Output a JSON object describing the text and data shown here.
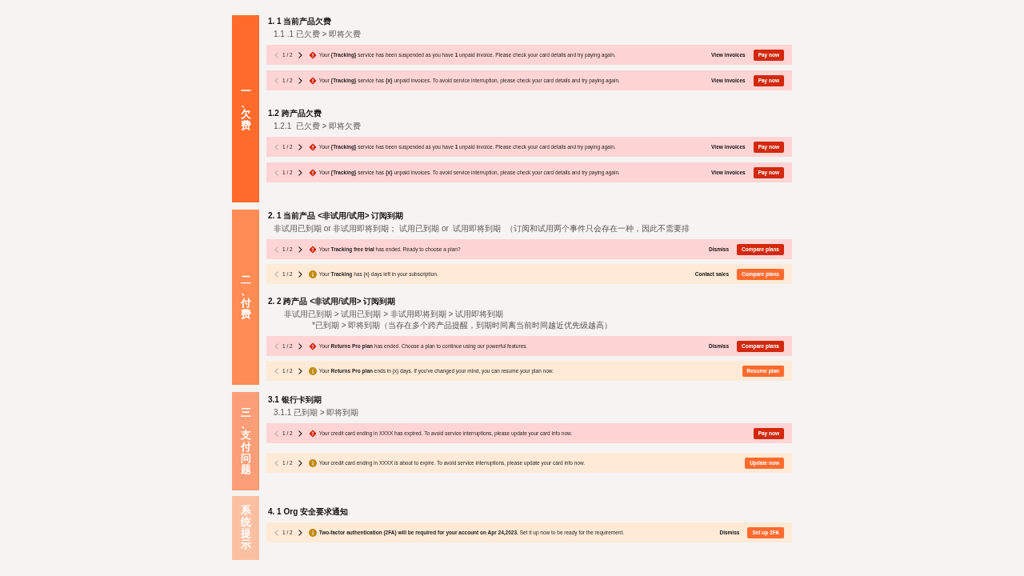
{
  "sections": [
    {
      "label": "一、欠费",
      "color": "#ff6b2b",
      "groups": [
        {
          "heading": "1. 1 当前产品欠费",
          "notes": [
            "1.1 .1 已欠费 > 即将欠费"
          ],
          "banners": [
            {
              "kind": "error",
              "pager": {
                "text": "1 / 2",
                "prev_disabled": true,
                "next_disabled": false
              },
              "message": "Your **{Tracking}** service has been suspended as you have **1** unpaid invoice. Please check your card details and try paying again.",
              "actions": [
                {
                  "kind": "link",
                  "label": "View invoices"
                },
                {
                  "kind": "primary",
                  "label": "Pay now"
                }
              ]
            },
            {
              "kind": "error",
              "pager": {
                "text": "1 / 2",
                "prev_disabled": true,
                "next_disabled": false
              },
              "message": "Your **{Tracking}** service has **{x}** unpaid invoices. To avoid service interruption, please check your card details and try paying again.",
              "actions": [
                {
                  "kind": "link",
                  "label": "View invoices"
                },
                {
                  "kind": "primary",
                  "label": "Pay now"
                }
              ]
            }
          ]
        },
        {
          "heading": "1.2 跨产品欠费",
          "notes": [
            "1.2.1  已欠费 > 即将欠费"
          ],
          "banners": [
            {
              "kind": "error",
              "pager": {
                "text": "1 / 2",
                "prev_disabled": true,
                "next_disabled": false
              },
              "message": "Your **{Tracking}** service has been suspended as you have **1** unpaid invoice. Please check your card details and try paying again.",
              "actions": [
                {
                  "kind": "link",
                  "label": "View invoices"
                },
                {
                  "kind": "primary",
                  "label": "Pay now"
                }
              ]
            },
            {
              "kind": "error",
              "pager": {
                "text": "1 / 2",
                "prev_disabled": true,
                "next_disabled": false
              },
              "message": "Your **{Tracking}** service has **{x}** unpaid invoices. To avoid service interruption, please check your card details and try paying again.",
              "actions": [
                {
                  "kind": "link",
                  "label": "View invoices"
                },
                {
                  "kind": "primary",
                  "label": "Pay now"
                }
              ]
            }
          ]
        }
      ]
    },
    {
      "label": "二、付费",
      "color": "#ff8b55",
      "groups": [
        {
          "heading": "2. 1 当前产品 <非试用/试用> 订阅到期",
          "notes": [
            "非试用已到期 or 非试用即将到期； 试用已到期 or  试用即将到期  （订阅和试用两个事件只会存在一种，因此不需要排"
          ],
          "banners": [
            {
              "kind": "error",
              "pager": {
                "text": "1 / 2",
                "prev_disabled": true,
                "next_disabled": false
              },
              "message": "Your **Tracking free trial** has ended. Ready to choose a plan?",
              "actions": [
                {
                  "kind": "link",
                  "label": "Dismiss"
                },
                {
                  "kind": "primary",
                  "label": "Compare plans"
                }
              ]
            },
            {
              "kind": "warning",
              "pager": {
                "text": "1 / 2",
                "prev_disabled": true,
                "next_disabled": false
              },
              "message": "Your **Tracking** has {x} days left in your subscription.",
              "actions": [
                {
                  "kind": "link",
                  "label": "Contact sales"
                },
                {
                  "kind": "primary",
                  "label": "Compare plans"
                }
              ]
            }
          ]
        },
        {
          "heading": "2. 2 跨产品 <非试用/试用> 订阅到期",
          "notes": [
            "非试用已到期 > 试用已到期 > 非试用即将到期 > 试用即将到期",
            "*已到期 > 即将到期（当存在多个跨产品提醒，到期时间离当前时间越近优先级越高）"
          ],
          "banners": [
            {
              "kind": "error",
              "pager": {
                "text": "1 / 2",
                "prev_disabled": true,
                "next_disabled": false
              },
              "message": "Your **Returns Pro plan** has ended. Choose a plan to continue using our powerful features.",
              "actions": [
                {
                  "kind": "link",
                  "label": "Dismiss"
                },
                {
                  "kind": "primary",
                  "label": "Compare plans"
                }
              ]
            },
            {
              "kind": "warning",
              "pager": {
                "text": "1 / 2",
                "prev_disabled": true,
                "next_disabled": false
              },
              "message": "Your **Returns Pro plan** ends in {x} days. If you've changed your mind, you can resume your plan now.",
              "actions": [
                {
                  "kind": "primary",
                  "label": "Resume plan"
                }
              ]
            }
          ]
        }
      ]
    },
    {
      "label": "三、支付问题",
      "color": "#fb9d76",
      "groups": [
        {
          "heading": "3.1 银行卡到期",
          "notes": [
            "3.1.1 已到期 > 即将到期"
          ],
          "banners": [
            {
              "kind": "error",
              "pager": {
                "text": "1 / 2",
                "prev_disabled": true,
                "next_disabled": false
              },
              "message": "Your credit card ending in XXXX has expired. To avoid service interruptions, please update your card info now.",
              "actions": [
                {
                  "kind": "primary",
                  "label": "Pay now"
                }
              ]
            },
            {
              "kind": "warning",
              "pager": {
                "text": "1 / 2",
                "prev_disabled": true,
                "next_disabled": false
              },
              "message": "Your credit card ending in XXXX is about to expire. To avoid service interruptions, please update your card info now.",
              "actions": [
                {
                  "kind": "primary",
                  "label": "Update now"
                }
              ]
            }
          ]
        }
      ]
    },
    {
      "label": "系统提示",
      "color": "#fbc0a2",
      "groups": [
        {
          "heading": "4. 1 Org 安全要求通知",
          "banners": [
            {
              "kind": "warning",
              "pager": {
                "text": "1 / 2",
                "prev_disabled": true,
                "next_disabled": false
              },
              "message": "**Two-factor authentication (2FA) will be required for your account on Apr 24,2023.** Set it up now to be ready for the requirement.",
              "actions": [
                {
                  "kind": "link",
                  "label": "Dismiss"
                },
                {
                  "kind": "primary",
                  "label": "Set up 2FA"
                }
              ]
            }
          ]
        }
      ]
    }
  ]
}
